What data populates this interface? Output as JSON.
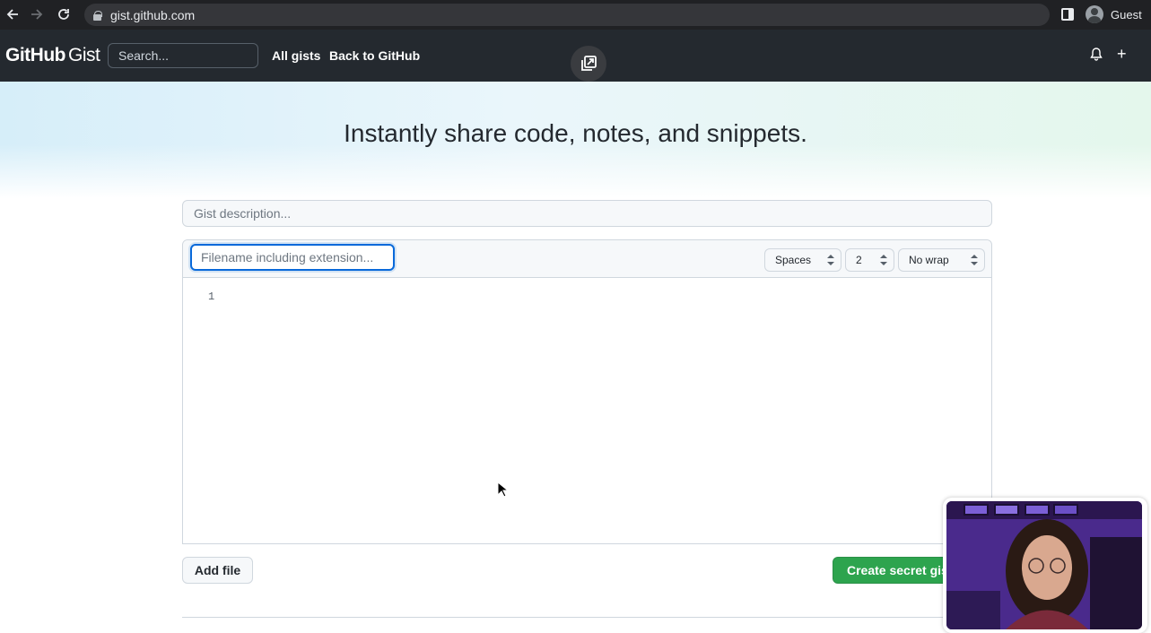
{
  "browser": {
    "url": "gist.github.com",
    "profile_name": "Guest"
  },
  "header": {
    "logo_brand": "GitHub",
    "logo_product": "Gist",
    "search_placeholder": "Search...",
    "nav": {
      "all_gists": "All gists",
      "back_to_github": "Back to GitHub"
    }
  },
  "hero": {
    "title": "Instantly share code, notes, and snippets."
  },
  "form": {
    "description_placeholder": "Gist description...",
    "filename_placeholder": "Filename including extension...",
    "indent_mode": "Spaces",
    "indent_size": "2",
    "wrap_mode": "No wrap",
    "line_number": "1",
    "add_file_label": "Add file",
    "create_label": "Create secret gist"
  },
  "colors": {
    "header_bg": "#24292f",
    "accent_blue": "#0969da",
    "create_green": "#2da44e"
  }
}
